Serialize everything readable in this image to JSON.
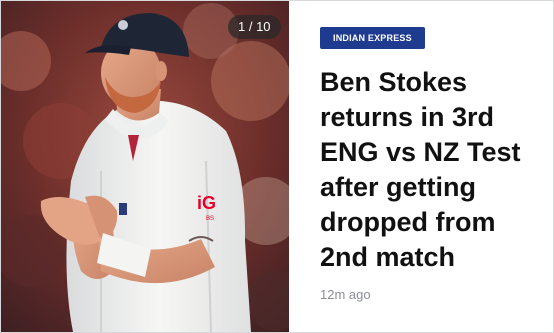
{
  "slide_counter": "1 / 10",
  "source": "INDIAN EXPRESS",
  "headline": "Ben Stokes returns in 3rd ENG vs NZ Test after getting dropped from 2nd match",
  "timestamp": "12m ago",
  "image": {
    "cap_logo": "england-cricket-crest",
    "sponsor_logo_text": "iG",
    "sponsor_sub_text": "BS"
  },
  "colors": {
    "badge_bg": "#1f3b8f",
    "headline": "#111111",
    "timestamp": "#8a8d91",
    "sponsor": "#e4002b",
    "cap": "#1e2535"
  }
}
